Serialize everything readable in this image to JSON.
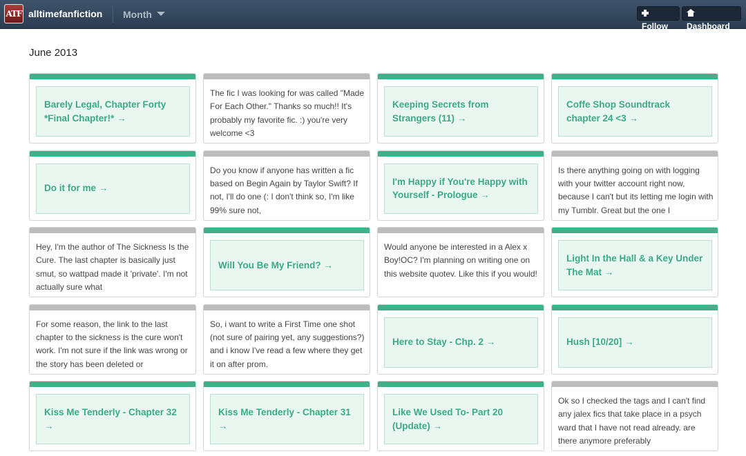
{
  "header": {
    "logo_text": "ATF",
    "blog_name": "alltimefanfiction",
    "month_label": "Month",
    "follow_label": "Follow",
    "dashboard_label": "Dashboard"
  },
  "archive": {
    "month_title": "June 2013",
    "posts": [
      {
        "type": "title",
        "text": "Barely Legal, Chapter Forty *Final Chapter!* →"
      },
      {
        "type": "text",
        "text": "The fic I was looking for was called \"Made For Each Other.\" Thanks so much!! It's probably my favorite fic. :) you're very welcome <3"
      },
      {
        "type": "title",
        "text": "Keeping Secrets from Strangers (11) →"
      },
      {
        "type": "title",
        "text": "Coffe Shop Soundtrack chapter 24 <3 →"
      },
      {
        "type": "title",
        "text": "Do it for me  →"
      },
      {
        "type": "text",
        "text": "Do you know if anyone has written a fic based on Begin Again by Taylor Swift? If not, I'll do one (: I don't think so, I'm like 99% sure not,"
      },
      {
        "type": "title",
        "text": "I'm Happy if You're Happy with Yourself - Prologue  →"
      },
      {
        "type": "text",
        "text": "Is there anything going on with logging with your twitter account right now, because I can't but its letting me login with my Tumblr. Great but the one I"
      },
      {
        "type": "text",
        "text": "Hey, I'm the author of The Sickness Is the Cure. The last chapter is basically just smut, so wattpad made it 'private'. I'm not actually sure what"
      },
      {
        "type": "title",
        "text": "Will You Be My Friend? →"
      },
      {
        "type": "text",
        "text": "Would anyone be interested in a Alex x Boy!OC? I'm planning on writing one on this website quotev. Like this if you would!"
      },
      {
        "type": "title",
        "text": "Light In the Hall & a Key Under The Mat →"
      },
      {
        "type": "text",
        "text": "For some reason, the link to the last chapter to the sickness is the cure won't work. I'm not sure if the link was wrong or the story has been deleted or"
      },
      {
        "type": "text",
        "text": "So, i want to write a First Time one shot (not sure of pairing yet, any suggestions?) and i know I've read a few where they get it on after prom."
      },
      {
        "type": "title",
        "text": "Here to Stay - Chp. 2 →"
      },
      {
        "type": "title",
        "text": "Hush [10/20] →"
      },
      {
        "type": "title",
        "text": "Kiss Me Tenderly - Chapter 32 →"
      },
      {
        "type": "title",
        "text": "Kiss Me Tenderly - Chapter 31 →"
      },
      {
        "type": "title",
        "text": "Like We Used To- Part 20 (Update) →"
      },
      {
        "type": "text",
        "text": "Ok so I checked the tags and I can't find any jalex fics that take place in a psych ward that I have not read already. are there anymore preferably"
      }
    ]
  }
}
